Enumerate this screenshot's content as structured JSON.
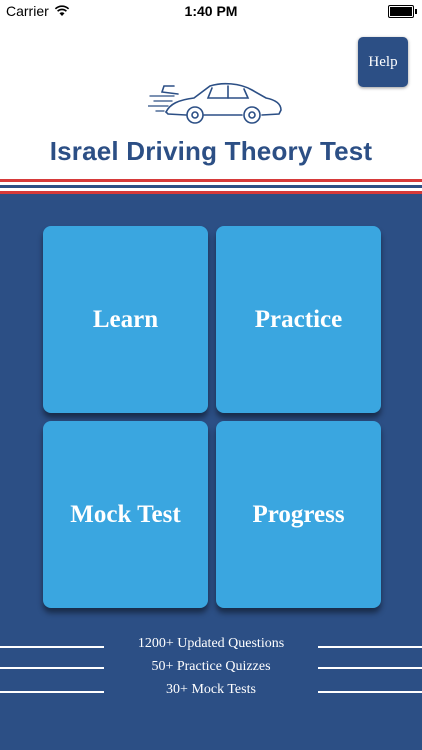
{
  "status_bar": {
    "carrier": "Carrier",
    "time": "1:40 PM",
    "wifi_icon": "wifi-icon",
    "battery_icon": "battery-icon"
  },
  "header": {
    "help_label": "Help",
    "logo_icon": "car-icon",
    "title": "Israel Driving Theory Test"
  },
  "colors": {
    "primary": "#2c4f85",
    "tile": "#3aa6e0",
    "accent_red": "#d63a3a"
  },
  "tiles": [
    {
      "label": "Learn"
    },
    {
      "label": "Practice"
    },
    {
      "label": "Mock Test"
    },
    {
      "label": "Progress"
    }
  ],
  "footer": {
    "lines": [
      "1200+ Updated Questions",
      "50+ Practice Quizzes",
      "30+ Mock Tests"
    ]
  }
}
